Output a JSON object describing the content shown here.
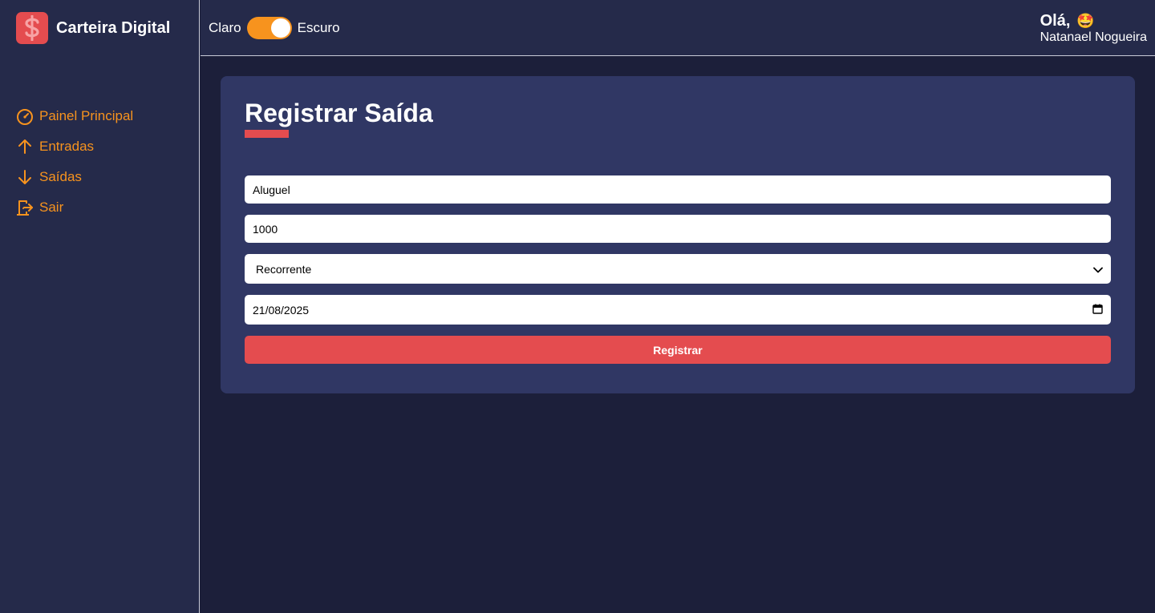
{
  "brand": {
    "title": "Carteira Digital",
    "logo_icon": "dollar-icon",
    "accent": "#e44c4f"
  },
  "sidebar": {
    "items": [
      {
        "label": "Painel Principal",
        "icon": "dashboard-gauge-icon"
      },
      {
        "label": "Entradas",
        "icon": "arrow-up-icon"
      },
      {
        "label": "Saídas",
        "icon": "arrow-down-icon"
      },
      {
        "label": "Sair",
        "icon": "exit-door-icon"
      }
    ],
    "item_color": "#f7931e"
  },
  "header": {
    "theme_light_label": "Claro",
    "theme_dark_label": "Escuro",
    "greeting": "Olá,",
    "greeting_emoji": "🤩",
    "user_name": "Natanael Nogueira"
  },
  "form": {
    "title": "Registrar Saída",
    "description_value": "Aluguel",
    "amount_value": "1000",
    "frequency_selected": "Recorrente",
    "date_value": "21/08/2025",
    "submit_label": "Registrar"
  }
}
